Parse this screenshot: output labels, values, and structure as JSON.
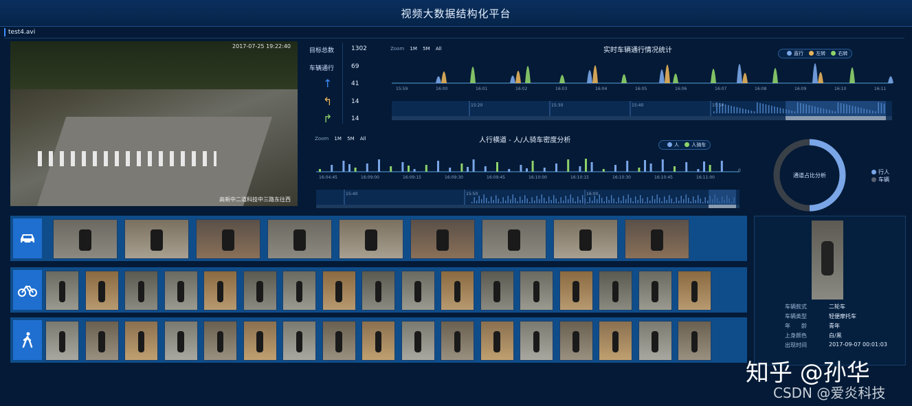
{
  "app": {
    "title": "视频大数据结构化平台",
    "tab": "test4.avi"
  },
  "video": {
    "timestamp": "2017-07-25 19:22:40",
    "caption": "高新中二道科技中三路东往西"
  },
  "stats": {
    "total_label": "目标总数",
    "total_value": "1302",
    "vehicle_label": "车辆通行",
    "vehicle_value": "69",
    "straight_value": "41",
    "left_value": "14",
    "right_value": "14"
  },
  "vehicle_chart": {
    "title": "实时车辆通行情况统计",
    "zoom_label": "Zoom",
    "zoom_opts": [
      "1M",
      "5M",
      "All"
    ],
    "legend": [
      "直行",
      "左转",
      "右转"
    ],
    "legend_colors": [
      "#7aa6e8",
      "#e8b25a",
      "#8fd36a"
    ],
    "ticks": [
      "15:59",
      "16:00",
      "16:01",
      "16:02",
      "16:03",
      "16:04",
      "16:05",
      "16:06",
      "16:07",
      "16:08",
      "16:09",
      "16:10",
      "16:11"
    ],
    "nav_ticks": [
      "15:20",
      "15:30",
      "15:40",
      "15:50"
    ]
  },
  "ped_chart": {
    "title": "人行横道 - 人/人骑车密度分析",
    "zoom_label": "Zoom",
    "zoom_opts": [
      "1M",
      "5M",
      "All"
    ],
    "legend": [
      "人",
      "人骑车"
    ],
    "legend_colors": [
      "#7aa6e8",
      "#8fd36a"
    ],
    "ticks": [
      "16:04:45",
      "16:09:00",
      "16:09:15",
      "16:09:30",
      "16:09:45",
      "16:10:00",
      "16:10:15",
      "16:10:30",
      "16:10:45",
      "16:11:00"
    ],
    "nav_ticks": [
      "15:40",
      "15:50",
      "16:00"
    ],
    "y_zero": "0"
  },
  "donut": {
    "center": "通道占比分析",
    "legend": [
      "行人",
      "车辆"
    ],
    "segments": [
      {
        "name": "行人",
        "value": 50
      },
      {
        "name": "车辆",
        "value": 50
      }
    ]
  },
  "rows": {
    "vehicle_icon": "car-icon",
    "bike_icon": "bicycle-icon",
    "person_icon": "pedestrian-icon"
  },
  "detail": {
    "labels": [
      "车辆款式",
      "车辆类型",
      "年　　龄",
      "上身颜色",
      "出现时间"
    ],
    "values": [
      "二轮车",
      "轻便摩托车",
      "青年",
      "白/黑",
      "2017-09-07 00:01:03"
    ]
  },
  "watermark": {
    "zhihu": "知乎 @孙华",
    "csdn": "CSDN @爱炎科技"
  }
}
